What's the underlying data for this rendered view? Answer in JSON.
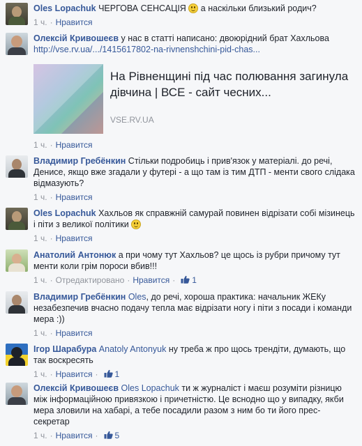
{
  "comments": [
    {
      "author": "Oles Lopachuk",
      "text_before": " ЧЕРГОВА СЕНСАЦІЯ ",
      "text_after": " а наскільки близький родич?",
      "time": "1 ч.",
      "like": "Нравится"
    },
    {
      "author": "Олексій Кривошеєв",
      "text": " у нас в статті написано: двоюрідний брат Хахльова",
      "link": "http://vse.rv.ua/.../1415617802-na-rivnenshchini-pid-chas...",
      "preview_title": "На Рівненщині під час полювання загинула дівчина | ВСЕ - сайт чесних...",
      "preview_domain": "VSE.RV.UA",
      "time": "1 ч.",
      "like": "Нравится"
    },
    {
      "author": "Владимир Гребёнкин",
      "text": " Стільки подробиць і прив'язок у матеріалі. до речі, Денисе, якщо вже згадали у футері - а що там із тим ДТП - менти свого слідака відмазують?",
      "time": "1 ч.",
      "like": "Нравится"
    },
    {
      "author": "Oles Lopachuk",
      "text": " Хахльов як справжній самурай повинен відрізати собі мізинець і піти з великої політики ",
      "time": "1 ч.",
      "like": "Нравится"
    },
    {
      "author": "Анатолий Антонюк",
      "text": " а при чому тут Хахльов? це щось із рубри причому тут менти коли грім пороси вбив!!!",
      "time": "1 ч.",
      "edited": "Отредактировано",
      "like": "Нравится",
      "likes": "1"
    },
    {
      "author": "Владимир Гребёнкин",
      "mention": "Oles",
      "text": ", до речі, хороша практика: начальник ЖЕКу незабезпечив вчасно подачу тепла має відрізати ногу і піти з посади і команди мера :))",
      "time": "1 ч.",
      "like": "Нравится"
    },
    {
      "author": "Ігор Шарабура",
      "mention": "Anatoly Antonyuk",
      "text": " ну треба ж про щось трендіти, думають, що так воскресять",
      "time": "1 ч.",
      "like": "Нравится",
      "likes": "1"
    },
    {
      "author": "Олексій Кривошеєв",
      "mention": "Oles Lopachuk",
      "text": " ти ж журналіст і маєш розуміти різницю між інформаційною привязкою і причетністю. Це вснодно що у випадку, якби мера зловили на хабарі, а тебе посадили разом з ним бо ти його прес-секретар",
      "time": "1 ч.",
      "like": "Нравится",
      "likes": "5"
    }
  ],
  "colors": {
    "link": "#365899",
    "meta": "#90949c",
    "background": "#f6f7f9"
  }
}
